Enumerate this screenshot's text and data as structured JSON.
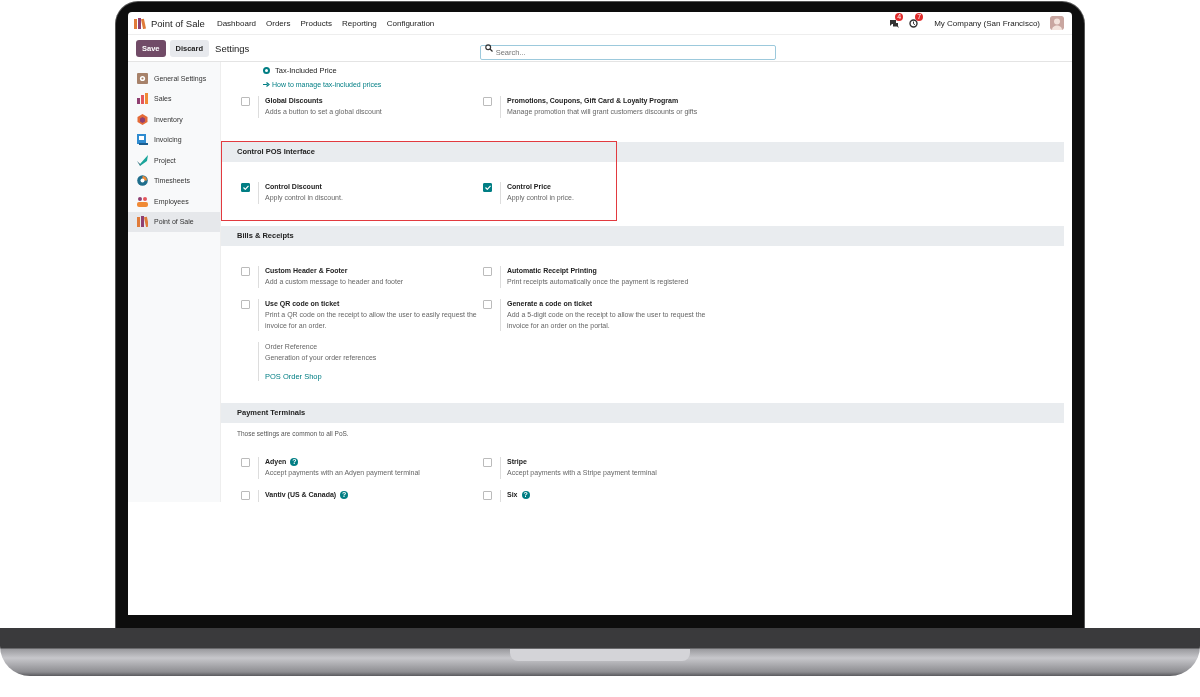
{
  "navbar": {
    "app_name": "Point of Sale",
    "menu": [
      "Dashboard",
      "Orders",
      "Products",
      "Reporting",
      "Configuration"
    ],
    "messages_badge": "4",
    "activity_badge": "7",
    "company": "My Company (San Francisco)"
  },
  "control_panel": {
    "save": "Save",
    "discard": "Discard",
    "breadcrumb": "Settings",
    "search": {
      "placeholder": "Search..."
    }
  },
  "sidebar": {
    "items": [
      {
        "label": "General Settings",
        "selected": false
      },
      {
        "label": "Sales",
        "selected": false
      },
      {
        "label": "Inventory",
        "selected": false
      },
      {
        "label": "Invoicing",
        "selected": false
      },
      {
        "label": "Project",
        "selected": false
      },
      {
        "label": "Timesheets",
        "selected": false
      },
      {
        "label": "Employees",
        "selected": false
      },
      {
        "label": "Point of Sale",
        "selected": true
      }
    ]
  },
  "sections": [
    {
      "highlighted": false,
      "settings": [
        {
          "kind": "radio",
          "label": "Tax-Included Price",
          "selected": true,
          "link": "How to manage tax-included prices"
        },
        {
          "kind": "checkbox",
          "title": "Global Discounts",
          "description": "Adds a button to set a global discount",
          "checked": false
        },
        {
          "kind": "checkbox",
          "title": "Promotions, Coupons, Gift Card & Loyalty Program",
          "description": "Manage promotion that will grant customers discounts or gifts",
          "checked": false
        }
      ]
    },
    {
      "title": "Control POS Interface",
      "highlighted": true,
      "settings": [
        {
          "kind": "checkbox",
          "title": "Control Discount",
          "description": "Apply control in discount.",
          "checked": true
        },
        {
          "kind": "checkbox",
          "title": "Control Price",
          "description": "Apply control in price.",
          "checked": true
        }
      ]
    },
    {
      "title": "Bills & Receipts",
      "highlighted": false,
      "settings": [
        {
          "kind": "checkbox",
          "title": "Custom Header & Footer",
          "description": "Add a custom message to header and footer",
          "checked": false
        },
        {
          "kind": "checkbox",
          "title": "Automatic Receipt Printing",
          "description": "Print receipts automatically once the payment is registered",
          "checked": false
        },
        {
          "kind": "checkbox",
          "title": "Use QR code on ticket",
          "description": "Print a QR code on the receipt to allow the user to easily request the invoice for an order.",
          "checked": false
        },
        {
          "kind": "checkbox",
          "title": "Generate a code on ticket",
          "description": "Add a 5-digit code on the receipt to allow the user to request the invoice for an order on the portal.",
          "checked": false
        },
        {
          "kind": "field",
          "title": "Order Reference",
          "description": "Generation of your order references",
          "link": "POS Order Shop"
        }
      ]
    },
    {
      "title": "Payment Terminals",
      "note": "Those settings are common to all PoS.",
      "highlighted": false,
      "settings": [
        {
          "kind": "checkbox",
          "title": "Adyen",
          "description": "Accept payments with an Adyen payment terminal",
          "checked": false,
          "help": "?"
        },
        {
          "kind": "checkbox",
          "title": "Stripe",
          "description": "Accept payments with a Stripe payment terminal",
          "checked": false
        },
        {
          "kind": "checkbox",
          "title": "Vantiv (US & Canada)",
          "checked": false,
          "help": "?"
        },
        {
          "kind": "checkbox",
          "title": "Six",
          "checked": false,
          "help": "?"
        }
      ]
    }
  ]
}
